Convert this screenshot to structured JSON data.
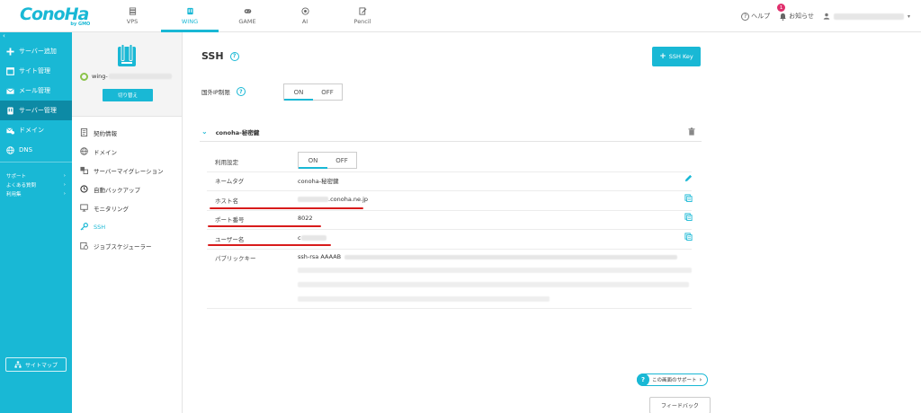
{
  "brand": {
    "logo": "ConoHa",
    "logo_sub": "by GMO",
    "accent": "#19b8d5"
  },
  "nav": {
    "items": [
      {
        "label": "VPS",
        "icon": "server-stack-icon",
        "active": false
      },
      {
        "label": "WING",
        "icon": "wing-icon",
        "active": true
      },
      {
        "label": "GAME",
        "icon": "gamepad-icon",
        "active": false
      },
      {
        "label": "AI",
        "icon": "ai-chip-icon",
        "active": false
      },
      {
        "label": "Pencil",
        "icon": "pencil-note-icon",
        "active": false
      }
    ]
  },
  "header_right": {
    "help": "ヘルプ",
    "notifications": "お知らせ",
    "notification_count": "1",
    "user": ""
  },
  "sidebar": {
    "collapse": "‹",
    "items": [
      {
        "label": "サーバー追加",
        "icon": "plus-icon",
        "active": false
      },
      {
        "label": "サイト管理",
        "icon": "site-icon",
        "active": false
      },
      {
        "label": "メール管理",
        "icon": "mail-icon",
        "active": false
      },
      {
        "label": "サーバー管理",
        "icon": "server-icon",
        "active": true
      },
      {
        "label": "ドメイン",
        "icon": "domain-icon",
        "active": false
      },
      {
        "label": "DNS",
        "icon": "globe-icon",
        "active": false
      }
    ],
    "small_links": [
      "サポート",
      "よくある質問",
      "利用集"
    ],
    "sitemap": "サイトマップ"
  },
  "server": {
    "name_prefix": "wing-",
    "switch_label": "切り替え",
    "status_color": "#8bc34a"
  },
  "sub_menu": [
    {
      "label": "契約情報",
      "icon": "contract-icon",
      "active": false
    },
    {
      "label": "ドメイン",
      "icon": "globe-icon",
      "active": false
    },
    {
      "label": "サーバーマイグレーション",
      "icon": "migration-icon",
      "active": false
    },
    {
      "label": "自動バックアップ",
      "icon": "backup-icon",
      "active": false
    },
    {
      "label": "モニタリング",
      "icon": "monitoring-icon",
      "active": false
    },
    {
      "label": "SSH",
      "icon": "key-icon",
      "active": true
    },
    {
      "label": "ジョブスケジューラー",
      "icon": "scheduler-icon",
      "active": false
    }
  ],
  "main": {
    "title": "SSH",
    "help": "?",
    "ssh_key_button": "SSH Key",
    "ip_restrict_label": "国外IP制限",
    "ip_toggle": {
      "on": "ON",
      "off": "OFF",
      "selected": "ON"
    },
    "key": {
      "name": "conoha-秘密鍵",
      "rows": {
        "usage_label": "利用設定",
        "usage_on": "ON",
        "usage_off": "OFF",
        "name_tag_label": "ネームタグ",
        "name_tag_value": "conoha-秘密鍵",
        "host_label": "ホスト名",
        "host_value": ".conoha.ne.jp",
        "port_label": "ポート番号",
        "port_value": "8022",
        "user_label": "ユーザー名",
        "user_value": "c",
        "pubkey_label": "パブリックキー",
        "pubkey_value": "ssh-rsa AAAAB"
      }
    },
    "support": "この画面のサポート",
    "feedback": "フィードバック",
    "highlight_color": "#d81b1b"
  }
}
